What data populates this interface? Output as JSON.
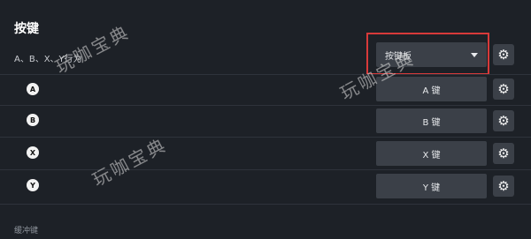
{
  "page": {
    "title": "按键",
    "section_label": "缓冲键"
  },
  "behavior_row": {
    "label": "A、B、X、Y行为",
    "dropdown_value": "按键板"
  },
  "keys": [
    {
      "badge": "A",
      "label": "A 键"
    },
    {
      "badge": "B",
      "label": "B 键"
    },
    {
      "badge": "X",
      "label": "X 键"
    },
    {
      "badge": "Y",
      "label": "Y 键"
    }
  ],
  "watermark": "玩咖宝典",
  "icons": {
    "settings": "gear-icon",
    "dropdown": "chevron-down-icon"
  },
  "colors": {
    "highlight": "#d83a3a",
    "background": "#1d2127",
    "control": "#3b4048"
  }
}
